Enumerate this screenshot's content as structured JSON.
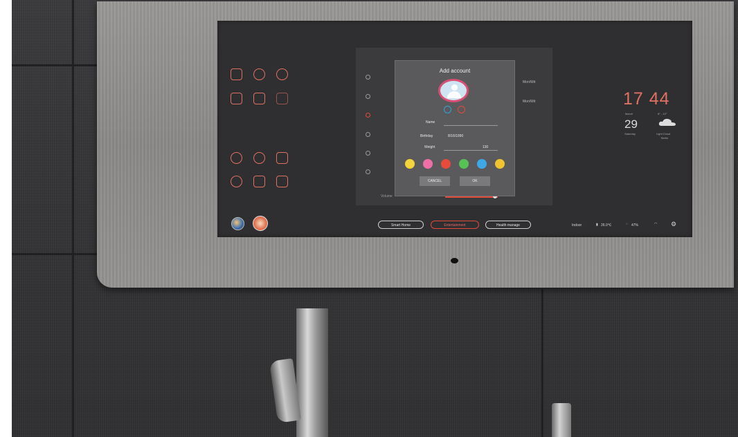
{
  "dialog": {
    "title": "Add account",
    "name_label": "Name",
    "name_value": "",
    "birthday_label": "Birthday",
    "birthday_value": "8/16/1990",
    "weight_label": "Weight",
    "weight_value": "130",
    "cancel_label": "CANCEL",
    "ok_label": "OK",
    "colors": [
      "#f3d43a",
      "#ee6fa6",
      "#e84a3c",
      "#58c155",
      "#3fa7e4",
      "#f0c430"
    ]
  },
  "clock": {
    "time": "17 44"
  },
  "weather": {
    "month": "March",
    "day": "29",
    "weekday": "Saturday",
    "temp_range": "8° - 12°",
    "condition": "Light Cloud",
    "city": "Berlin"
  },
  "nav_pills": [
    "Smart Home",
    "Entertainment",
    "Health manage"
  ],
  "status_bar": {
    "location": "Indoor",
    "temperature": "26.0℃",
    "humidity": "47%"
  },
  "side_values": [
    "Mon/Wit",
    "Mon/Wit"
  ],
  "slider_label": "Volume",
  "accent_color": "#e07062",
  "active_color": "#e24a3b"
}
